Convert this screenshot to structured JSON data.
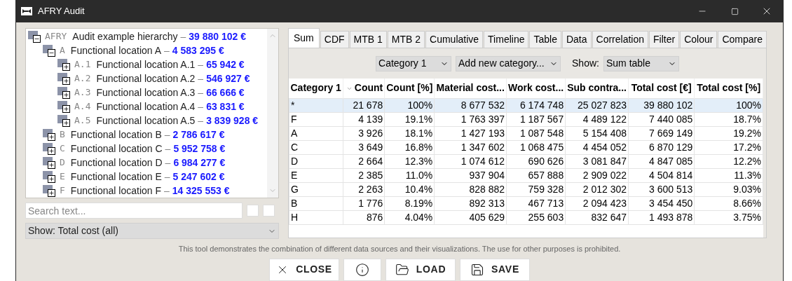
{
  "window": {
    "title": "AFRY Audit"
  },
  "tree": [
    {
      "code": "AFRY",
      "name": "Audit example hierarchy",
      "amount": "39 880 102 €",
      "expanded": true,
      "children": [
        {
          "code": "A",
          "name": "Functional location A",
          "amount": "4 583 295 €",
          "expanded": true,
          "children": [
            {
              "code": "A.1",
              "name": "Functional location A.1",
              "amount": "65 942 €",
              "expanded": false
            },
            {
              "code": "A.2",
              "name": "Functional location A.2",
              "amount": "546 927 €",
              "expanded": false
            },
            {
              "code": "A.3",
              "name": "Functional location A.3",
              "amount": "66 666 €",
              "expanded": false
            },
            {
              "code": "A.4",
              "name": "Functional location A.4",
              "amount": "63 831 €",
              "expanded": false
            },
            {
              "code": "A.5",
              "name": "Functional location A.5",
              "amount": "3 839 928 €",
              "expanded": false
            }
          ]
        },
        {
          "code": "B",
          "name": "Functional location B",
          "amount": "2 786 617 €",
          "expanded": false
        },
        {
          "code": "C",
          "name": "Functional location C",
          "amount": "5 952 758 €",
          "expanded": false
        },
        {
          "code": "D",
          "name": "Functional location D",
          "amount": "6 984 277 €",
          "expanded": false
        },
        {
          "code": "E",
          "name": "Functional location E",
          "amount": "5 247 602 €",
          "expanded": false
        },
        {
          "code": "F",
          "name": "Functional location F",
          "amount": "14 325 553 €",
          "expanded": false
        }
      ]
    }
  ],
  "search": {
    "placeholder": "Search text...",
    "options": [
      {
        "checked": false
      },
      {
        "checked": false
      }
    ]
  },
  "tree_separator": "–",
  "show_select": {
    "value": "Show: Total cost (all)"
  },
  "tabs": [
    {
      "label": "Sum",
      "selected": true
    },
    {
      "label": "CDF",
      "selected": false
    },
    {
      "label": "MTB 1",
      "selected": false
    },
    {
      "label": "MTB 2",
      "selected": false
    },
    {
      "label": "Cumulative",
      "selected": false
    },
    {
      "label": "Timeline",
      "selected": false
    },
    {
      "label": "Table",
      "selected": false
    },
    {
      "label": "Data",
      "selected": false
    },
    {
      "label": "Correlation",
      "selected": false
    },
    {
      "label": "Filter",
      "selected": false
    },
    {
      "label": "Colour",
      "selected": false
    },
    {
      "label": "Compare",
      "selected": false
    }
  ],
  "controls": {
    "category": "Category 1",
    "add_category": "Add new category...",
    "show_label": "Show:",
    "show_value": "Sum table"
  },
  "table": {
    "columns": [
      {
        "label": "Category 1",
        "sorted": false
      },
      {
        "label": "Count",
        "sorted": true
      },
      {
        "label": "Count [%]",
        "sorted": false
      },
      {
        "label": "Material cost...",
        "sorted": false
      },
      {
        "label": "Work cost...",
        "sorted": false
      },
      {
        "label": "Sub contra...",
        "sorted": false
      },
      {
        "label": "Total cost [€]",
        "sorted": false
      },
      {
        "label": "Total cost [%]",
        "sorted": false
      }
    ],
    "rows": [
      {
        "selected": true,
        "cells": [
          "*",
          "21 678",
          "100%",
          "8 677 532",
          "6 174 748",
          "25 027 823",
          "39 880 102",
          "100%"
        ]
      },
      {
        "selected": false,
        "cells": [
          "F",
          "4 139",
          "19.1%",
          "1 763 397",
          "1 187 567",
          "4 489 122",
          "7 440 085",
          "18.7%"
        ]
      },
      {
        "selected": false,
        "cells": [
          "A",
          "3 926",
          "18.1%",
          "1 427 193",
          "1 087 548",
          "5 154 408",
          "7 669 149",
          "19.2%"
        ]
      },
      {
        "selected": false,
        "cells": [
          "C",
          "3 649",
          "16.8%",
          "1 347 602",
          "1 068 475",
          "4 454 052",
          "6 870 129",
          "17.2%"
        ]
      },
      {
        "selected": false,
        "cells": [
          "D",
          "2 664",
          "12.3%",
          "1 074 612",
          "690 626",
          "3 081 847",
          "4 847 085",
          "12.2%"
        ]
      },
      {
        "selected": false,
        "cells": [
          "E",
          "2 385",
          "11.0%",
          "937 904",
          "657 888",
          "2 909 022",
          "4 504 814",
          "11.3%"
        ]
      },
      {
        "selected": false,
        "cells": [
          "G",
          "2 263",
          "10.4%",
          "828 882",
          "759 328",
          "2 012 302",
          "3 600 513",
          "9.03%"
        ]
      },
      {
        "selected": false,
        "cells": [
          "B",
          "1 776",
          "8.19%",
          "892 313",
          "467 713",
          "2 094 423",
          "3 454 450",
          "8.66%"
        ]
      },
      {
        "selected": false,
        "cells": [
          "H",
          "876",
          "4.04%",
          "405 629",
          "255 603",
          "832 647",
          "1 493 878",
          "3.75%"
        ]
      }
    ]
  },
  "footer": {
    "notice": "This tool demonstrates the combination of different data sources and their visualizations. The use for other purposes is prohibited."
  },
  "buttons": [
    {
      "kind": "close",
      "label": "CLOSE"
    },
    {
      "kind": "info"
    },
    {
      "kind": "load",
      "label": "LOAD"
    },
    {
      "kind": "save",
      "label": "SAVE"
    }
  ]
}
